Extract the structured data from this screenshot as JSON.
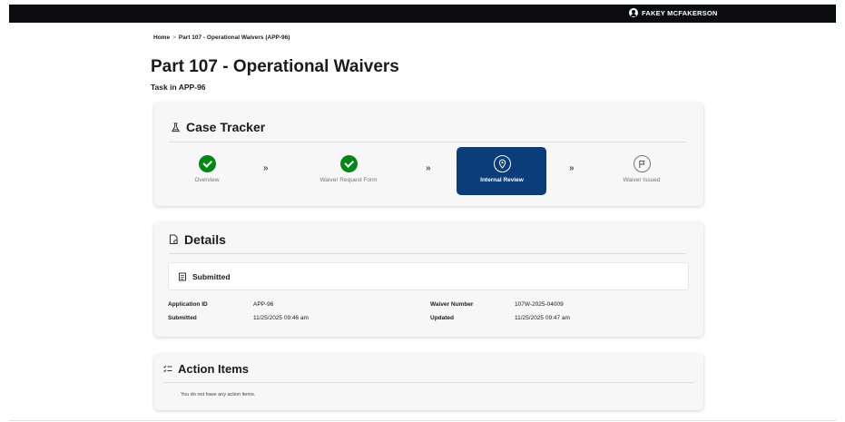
{
  "header": {
    "user_name": "FAKEY MCFAKERSON"
  },
  "breadcrumb": {
    "home": "Home",
    "separator": ">",
    "current": "Part 107 - Operational Waivers (APP-96)"
  },
  "page": {
    "title": "Part 107 - Operational Waivers",
    "subtitle": "Task in APP-96"
  },
  "case_tracker": {
    "title": "Case Tracker",
    "steps": [
      {
        "label": "Overview",
        "status": "complete"
      },
      {
        "label": "Waiver Request Form",
        "status": "complete"
      },
      {
        "label": "Internal Review",
        "status": "active"
      },
      {
        "label": "Waiver Issued",
        "status": "pending"
      }
    ],
    "separator": "»"
  },
  "details": {
    "title": "Details",
    "status": "Submitted",
    "fields": {
      "application_id_label": "Application ID",
      "application_id": "APP-96",
      "submitted_label": "Submitted",
      "submitted": "11/25/2025 09:46 am",
      "waiver_number_label": "Waiver Number",
      "waiver_number": "107W-2025-04009",
      "updated_label": "Updated",
      "updated": "11/25/2025 09:47 am"
    }
  },
  "action_items": {
    "title": "Action Items",
    "empty_message": "You do not have any action items."
  },
  "colors": {
    "topbar": "#0b0c10",
    "active_step": "#0b3d7a",
    "complete": "#008817"
  }
}
